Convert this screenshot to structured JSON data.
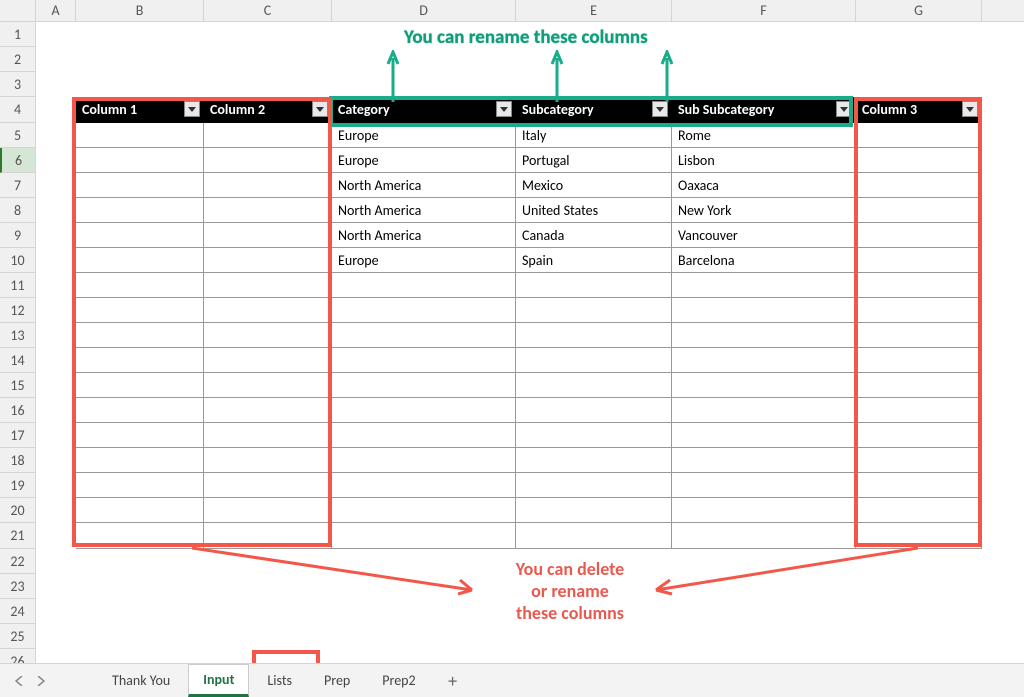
{
  "columns": [
    "A",
    "B",
    "C",
    "D",
    "E",
    "F",
    "G"
  ],
  "rownums_visible": [
    1,
    2,
    3,
    4,
    5,
    6,
    7,
    8,
    9,
    10,
    11,
    12,
    13,
    14,
    15,
    16,
    17,
    18,
    19,
    20,
    21,
    22,
    23,
    24,
    25,
    26
  ],
  "table": {
    "headers": {
      "col_b": "Column 1",
      "col_c": "Column 2",
      "col_d": "Category",
      "col_e": "Subcategory",
      "col_f": "Sub Subcategory",
      "col_g": "Column 3"
    },
    "rows": [
      {
        "d": "Europe",
        "e": "Italy",
        "f": "Rome"
      },
      {
        "d": "Europe",
        "e": "Portugal",
        "f": "Lisbon"
      },
      {
        "d": "North America",
        "e": "Mexico",
        "f": "Oaxaca"
      },
      {
        "d": "North America",
        "e": "United States",
        "f": "New York"
      },
      {
        "d": "North America",
        "e": "Canada",
        "f": "Vancouver"
      },
      {
        "d": "Europe",
        "e": "Spain",
        "f": "Barcelona"
      }
    ]
  },
  "annotations": {
    "top_text": "You can rename these columns",
    "bottom_text": "You can delete\nor rename\nthese columns"
  },
  "sheet_tabs": {
    "tab1": "Thank You",
    "tab2": "Input",
    "tab3": "Lists",
    "tab4": "Prep",
    "tab5": "Prep2",
    "active": "Input"
  },
  "colors": {
    "green": "#1aab8a",
    "red": "#f25749"
  }
}
